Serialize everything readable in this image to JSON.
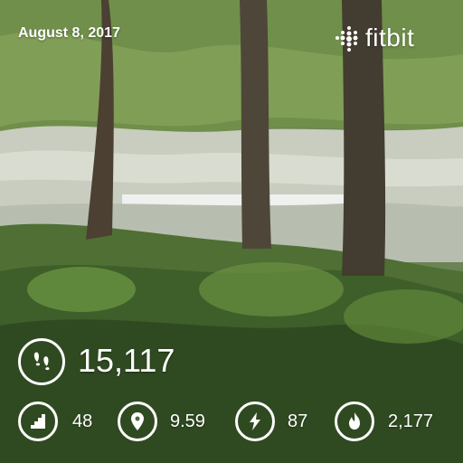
{
  "photo": {
    "date": "August 8, 2017",
    "brand": "fitbit",
    "brand_color": "#ffffff"
  },
  "stats": {
    "steps": "15,117",
    "floors": "48",
    "distance": "9.59",
    "active_minutes": "87",
    "calories": "2,177"
  },
  "icons": {
    "steps": "footprints-icon",
    "floors": "stairs-icon",
    "distance": "location-pin-icon",
    "active_minutes": "lightning-bolt-icon",
    "calories": "flame-icon",
    "brand": "fitbit-logo-icon"
  }
}
